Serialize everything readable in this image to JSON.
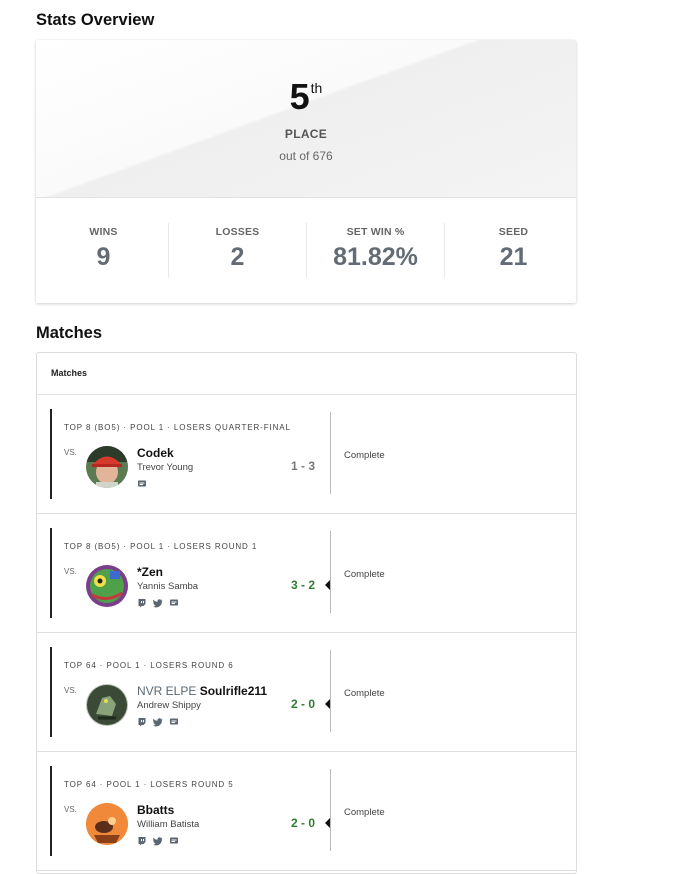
{
  "stats_overview": {
    "title": "Stats Overview",
    "place": "5",
    "place_suffix": "th",
    "place_label": "PLACE",
    "place_sub": "out of 676",
    "stats": [
      {
        "label": "WINS",
        "value": "9"
      },
      {
        "label": "LOSSES",
        "value": "2"
      },
      {
        "label": "SET WIN %",
        "value": "81.82%"
      },
      {
        "label": "SEED",
        "value": "21"
      }
    ]
  },
  "matches": {
    "title": "Matches",
    "card_header": "Matches",
    "rows": [
      {
        "round": "TOP 8 (BO5) · POOL 1 · LOSERS QUARTER-FINAL",
        "vs": "VS.",
        "prefix": "",
        "name": "Codek",
        "realname": "Trevor Young",
        "score": "1 - 3",
        "result": "loss",
        "status": "Complete",
        "socials": [
          "chat-icon"
        ]
      },
      {
        "round": "TOP 8 (BO5) · POOL 1 · LOSERS ROUND 1",
        "vs": "VS.",
        "prefix": "",
        "name": "*Zen",
        "realname": "Yannis Samba",
        "score": "3 - 2",
        "result": "win",
        "status": "Complete",
        "socials": [
          "twitch-icon",
          "twitter-icon",
          "chat-icon"
        ]
      },
      {
        "round": "TOP 64 · POOL 1 · LOSERS ROUND 6",
        "vs": "VS.",
        "prefix": "NVR ELPE",
        "name": "Soulrifle211",
        "realname": "Andrew Shippy",
        "score": "2 - 0",
        "result": "win",
        "status": "Complete",
        "socials": [
          "twitch-icon",
          "twitter-icon",
          "chat-icon"
        ]
      },
      {
        "round": "TOP 64 · POOL 1 · LOSERS ROUND 5",
        "vs": "VS.",
        "prefix": "",
        "name": "Bbatts",
        "realname": "William Batista",
        "score": "2 - 0",
        "result": "win",
        "status": "Complete",
        "socials": [
          "twitch-icon",
          "twitter-icon",
          "chat-icon"
        ]
      }
    ]
  },
  "colors": {
    "win_score": "#2e7d32",
    "loss_score": "#777777",
    "stat_value": "#636b75"
  }
}
